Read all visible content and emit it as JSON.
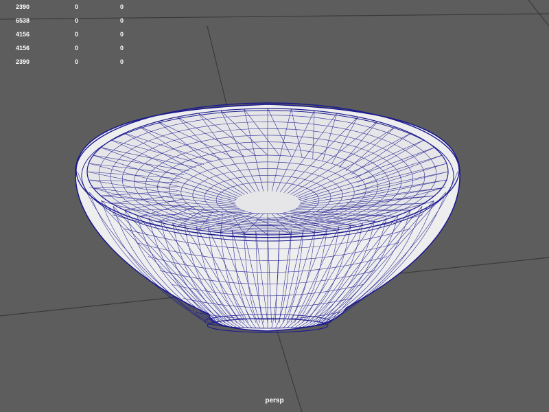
{
  "viewport": {
    "camera_label": "persp",
    "background_color": "#5d5d5d",
    "grid_color": "#3a3a3a",
    "wireframe_color": "#1c1a8f",
    "surface_color": "#eeeeee"
  },
  "hud": {
    "stats": [
      [
        "2390",
        "0",
        "0"
      ],
      [
        "6538",
        "0",
        "0"
      ],
      [
        "4156",
        "0",
        "0"
      ],
      [
        "4156",
        "0",
        "0"
      ],
      [
        "2390",
        "0",
        "0"
      ]
    ]
  },
  "objects": [
    {
      "name": "bowl",
      "icon": "mesh-wireframe"
    }
  ]
}
